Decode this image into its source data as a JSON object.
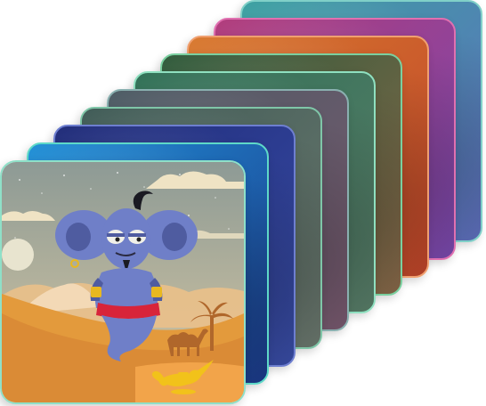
{
  "gallery": {
    "front_card": {
      "subject": "genie",
      "background": {
        "sky_top": "#8d9a95",
        "sky_bottom": "#d9c9a3",
        "sand": "#e39a3c",
        "dune_dark": "#c9702a",
        "moon": "#e8e4cf"
      },
      "genie": {
        "skin": "#6f7fc8",
        "skin_shadow": "#4f5ca0",
        "belt": "#d8243a",
        "cuff": "#e8b820",
        "hair": "#1a1a22"
      },
      "lamp_color": "#f2c21a",
      "silhouette_color": "#b0672b"
    },
    "back_cards": [
      {
        "edge": "#5ed9c8",
        "tint_a": "#1f8fd6",
        "tint_b": "#1c3a8a"
      },
      {
        "edge": "#6e7fd0",
        "tint_a": "#1e2a78",
        "tint_b": "#3a4ea8"
      },
      {
        "edge": "#7fc6a8",
        "tint_a": "#3e5a55",
        "tint_b": "#6d7a70"
      },
      {
        "edge": "#8ab0b0",
        "tint_a": "#4b5a63",
        "tint_b": "#7a5a70"
      },
      {
        "edge": "#8fe0c0",
        "tint_a": "#2f6f55",
        "tint_b": "#5a7f6a"
      },
      {
        "edge": "#7ad0a0",
        "tint_a": "#2e5a3a",
        "tint_b": "#8a6a4a"
      },
      {
        "edge": "#f0a070",
        "tint_a": "#d8782e",
        "tint_b": "#c0452a"
      },
      {
        "edge": "#e070b0",
        "tint_a": "#b03a7a",
        "tint_b": "#7a4ab0"
      },
      {
        "edge": "#80d0c8",
        "tint_a": "#3aa0a0",
        "tint_b": "#6070c0"
      }
    ]
  }
}
